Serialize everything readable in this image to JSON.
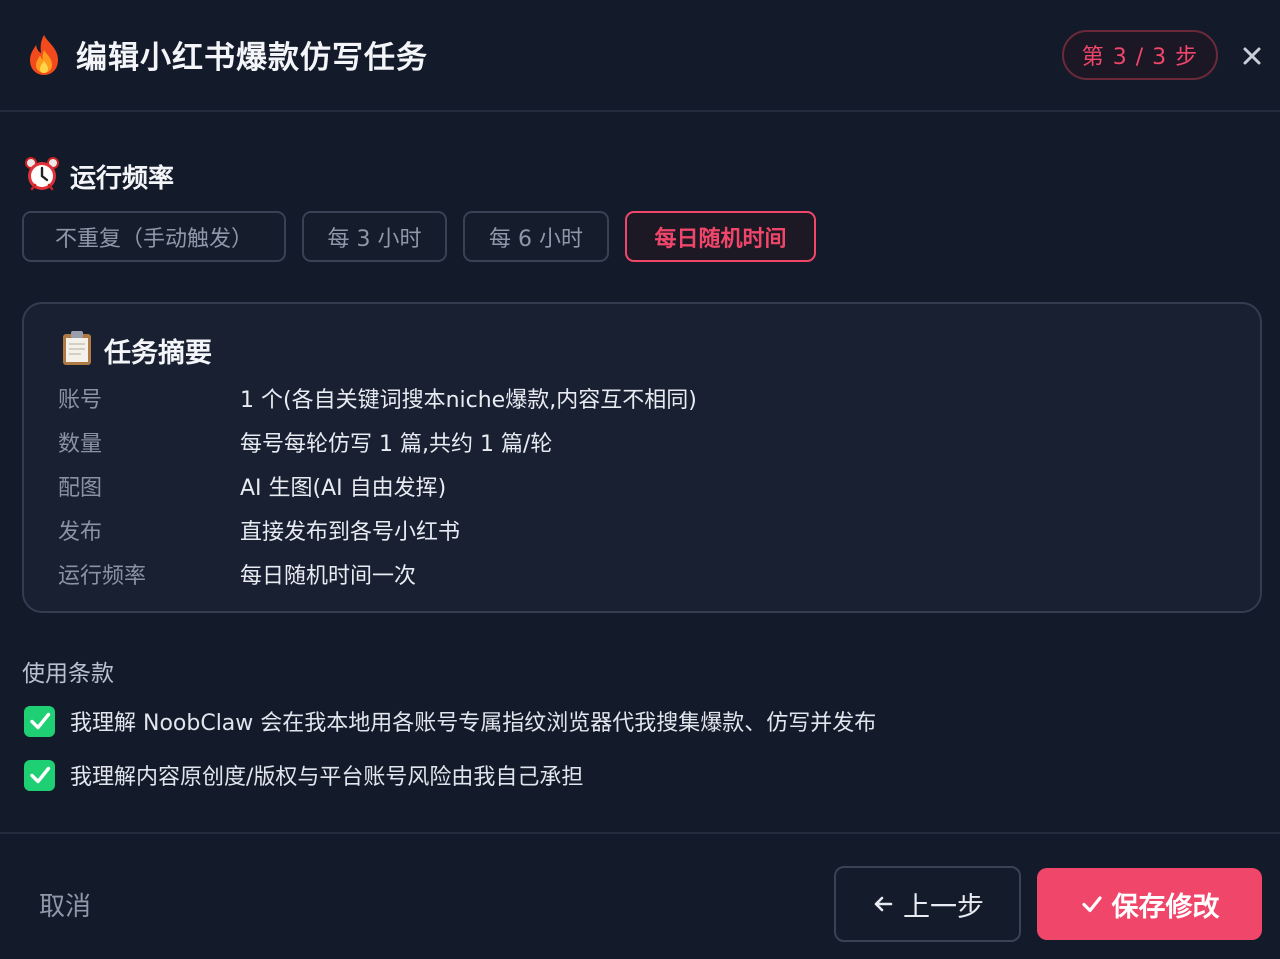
{
  "header": {
    "icon": "fire-icon",
    "title": "编辑小红书爆款仿写任务",
    "step_badge": "第 3 / 3 步",
    "close_icon": "close-icon"
  },
  "frequency": {
    "icon": "alarm-clock-icon",
    "title": "运行频率",
    "options": [
      {
        "label": "不重复（手动触发）",
        "selected": false
      },
      {
        "label": "每 3 小时",
        "selected": false
      },
      {
        "label": "每 6 小时",
        "selected": false
      },
      {
        "label": "每日随机时间",
        "selected": true
      }
    ]
  },
  "summary": {
    "icon": "clipboard-icon",
    "title": "任务摘要",
    "rows": [
      {
        "key": "账号",
        "value": "1 个(各自关键词搜本niche爆款,内容互不相同)"
      },
      {
        "key": "数量",
        "value": "每号每轮仿写 1 篇,共约 1 篇/轮"
      },
      {
        "key": "配图",
        "value": "AI 生图(AI 自由发挥)"
      },
      {
        "key": "发布",
        "value": "直接发布到各号小红书"
      },
      {
        "key": "运行频率",
        "value": "每日随机时间一次"
      }
    ]
  },
  "terms": {
    "title": "使用条款",
    "items": [
      {
        "text": "我理解 NoobClaw 会在我本地用各账号专属指纹浏览器代我搜集爆款、仿写并发布",
        "checked": true
      },
      {
        "text": "我理解内容原创度/版权与平台账号风险由我自己承担",
        "checked": true
      }
    ]
  },
  "footer": {
    "cancel_label": "取消",
    "prev_label": "上一步",
    "save_label": "保存修改"
  },
  "colors": {
    "background": "#131a29",
    "accent": "#f0466a",
    "check_green": "#1fcf73",
    "border": "#394254"
  }
}
